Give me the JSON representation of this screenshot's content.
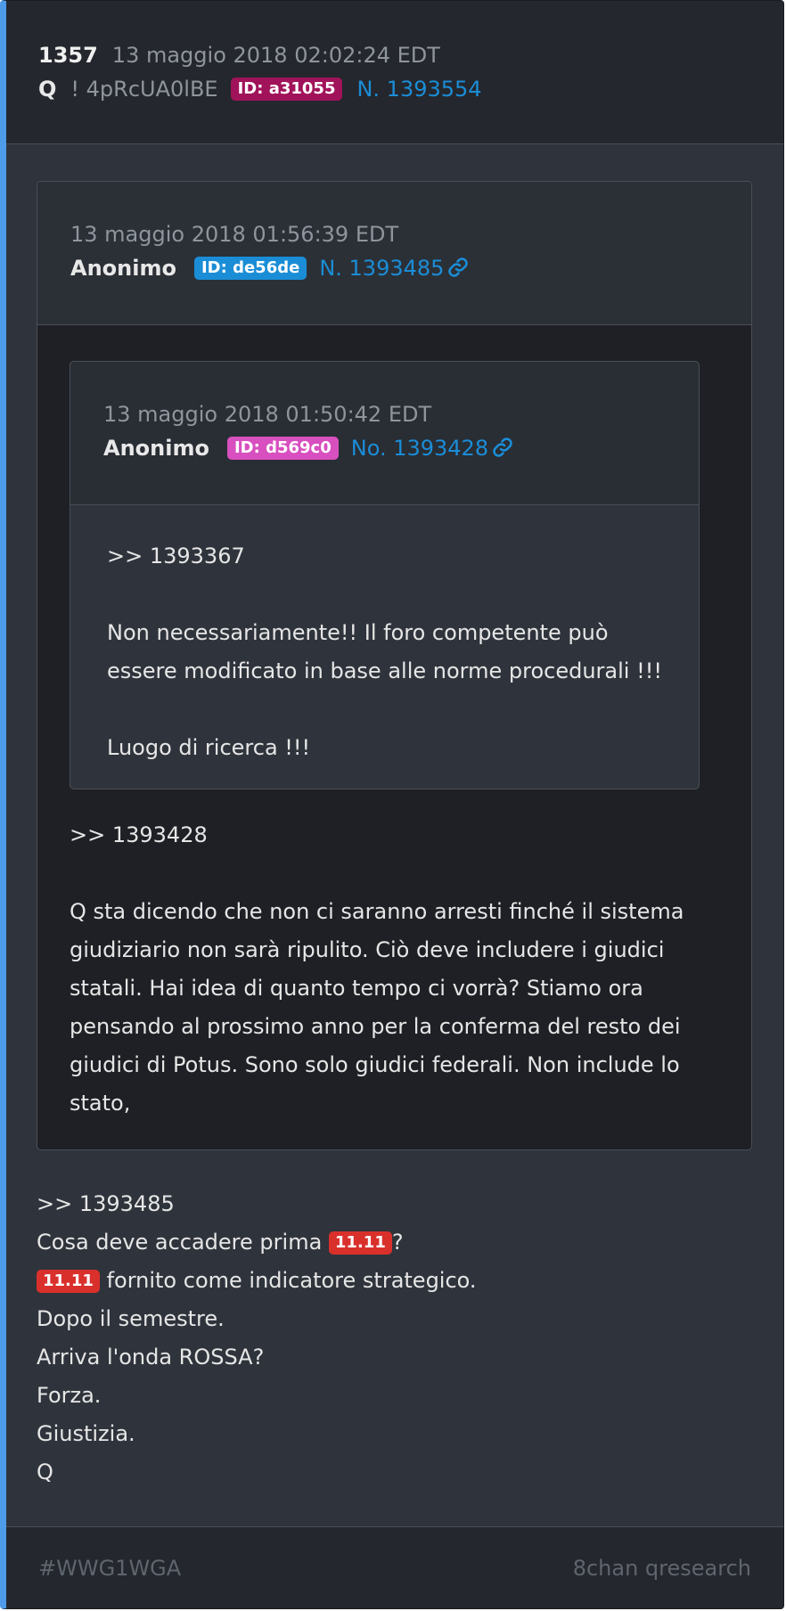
{
  "post": {
    "number": "1357",
    "timestamp": "13 maggio 2018 02:02:24 EDT",
    "author": "Q",
    "tripcode": "! 4pRcUA0lBE",
    "id_badge": "ID: a31055",
    "post_link": "N. 1393554",
    "body_lines": [
      ">> 1393485",
      "Cosa deve accadere prima ",
      "?",
      " fornito come indicatore strategico.",
      "Dopo il semestre.",
      "Arriva l'onda ROSSA?",
      "Forza.",
      "Giustizia.",
      "Q"
    ],
    "highlight": "11.11"
  },
  "quote1": {
    "timestamp": "13 maggio 2018 01:56:39 EDT",
    "author": "Anonimo",
    "id_badge": "ID: de56de",
    "post_link": "N. 1393485",
    "link_icon": "link-icon",
    "reply_ref": ">> 1393428",
    "text": "Q sta dicendo che non ci saranno arresti finché il sistema giudiziario non sarà ripulito. Ciò deve includere i giudici statali. Hai idea di quanto tempo ci vorrà? Stiamo ora pensando al prossimo anno per la conferma del resto dei giudici di Potus. Sono solo giudici federali. Non include lo stato,"
  },
  "quote2": {
    "timestamp": "13 maggio 2018 01:50:42 EDT",
    "author": "Anonimo",
    "id_badge": "ID: d569c0",
    "post_link": "No. 1393428",
    "link_icon": "link-icon",
    "reply_ref": ">> 1393367",
    "text1": "Non necessariamente!! Il foro competente può essere modificato in base alle norme procedurali !!!",
    "text2": "Luogo di ricerca !!!"
  },
  "footer": {
    "hashtag": "#WWG1WGA",
    "source": "8chan qresearch"
  },
  "colors": {
    "accent_border": "#4e9be9",
    "id_q": "#a0135a",
    "id_quote1": "#1b8dd6",
    "id_quote2": "#d84fbf",
    "highlight": "#d9302c",
    "link": "#1b8dd6"
  }
}
